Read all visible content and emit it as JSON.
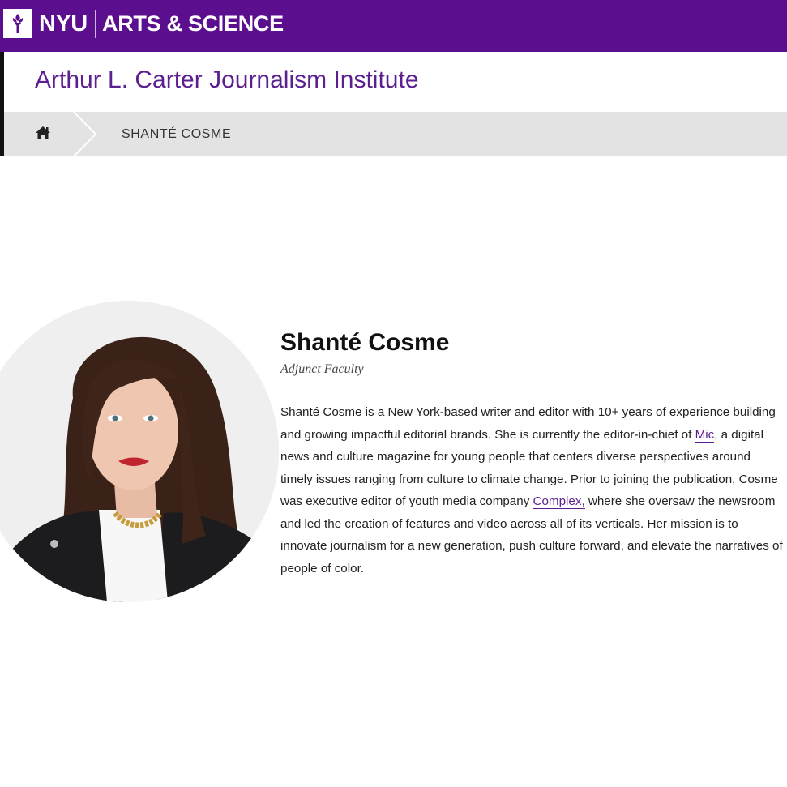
{
  "header": {
    "brand_nyu": "NYU",
    "brand_unit": "ARTS & SCIENCE",
    "institute_title": "Arthur L. Carter Journalism Institute",
    "accent_color": "#5b0f8f"
  },
  "breadcrumb": {
    "home_icon": "home-icon",
    "current": "SHANTÉ COSME"
  },
  "profile": {
    "name": "Shanté Cosme",
    "role": "Adjunct Faculty",
    "bio": {
      "p1": "Shanté Cosme is a New York-based writer and editor with 10+ years of experience building and growing impactful editorial brands. She is currently the editor-in-chief of ",
      "link1": "Mic",
      "p2": ", a digital news and culture magazine for young people that centers diverse perspectives around timely issues ranging from culture to climate change. Prior to joining the publication, Cosme was executive editor of youth media company ",
      "link2": "Complex,",
      "p3": " where she oversaw the newsroom and led the creation of features and video across all of its verticals. Her mission is to innovate journalism for a new generation, push culture forward, and elevate the narratives of people of color."
    }
  }
}
